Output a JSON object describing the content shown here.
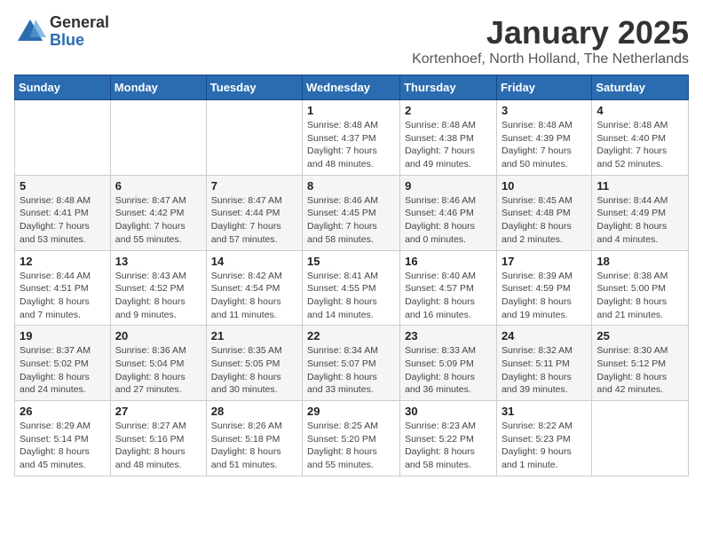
{
  "header": {
    "logo_general": "General",
    "logo_blue": "Blue",
    "title": "January 2025",
    "location": "Kortenhoef, North Holland, The Netherlands"
  },
  "days_of_week": [
    "Sunday",
    "Monday",
    "Tuesday",
    "Wednesday",
    "Thursday",
    "Friday",
    "Saturday"
  ],
  "weeks": [
    [
      {
        "day": "",
        "info": ""
      },
      {
        "day": "",
        "info": ""
      },
      {
        "day": "",
        "info": ""
      },
      {
        "day": "1",
        "info": "Sunrise: 8:48 AM\nSunset: 4:37 PM\nDaylight: 7 hours\nand 48 minutes."
      },
      {
        "day": "2",
        "info": "Sunrise: 8:48 AM\nSunset: 4:38 PM\nDaylight: 7 hours\nand 49 minutes."
      },
      {
        "day": "3",
        "info": "Sunrise: 8:48 AM\nSunset: 4:39 PM\nDaylight: 7 hours\nand 50 minutes."
      },
      {
        "day": "4",
        "info": "Sunrise: 8:48 AM\nSunset: 4:40 PM\nDaylight: 7 hours\nand 52 minutes."
      }
    ],
    [
      {
        "day": "5",
        "info": "Sunrise: 8:48 AM\nSunset: 4:41 PM\nDaylight: 7 hours\nand 53 minutes."
      },
      {
        "day": "6",
        "info": "Sunrise: 8:47 AM\nSunset: 4:42 PM\nDaylight: 7 hours\nand 55 minutes."
      },
      {
        "day": "7",
        "info": "Sunrise: 8:47 AM\nSunset: 4:44 PM\nDaylight: 7 hours\nand 57 minutes."
      },
      {
        "day": "8",
        "info": "Sunrise: 8:46 AM\nSunset: 4:45 PM\nDaylight: 7 hours\nand 58 minutes."
      },
      {
        "day": "9",
        "info": "Sunrise: 8:46 AM\nSunset: 4:46 PM\nDaylight: 8 hours\nand 0 minutes."
      },
      {
        "day": "10",
        "info": "Sunrise: 8:45 AM\nSunset: 4:48 PM\nDaylight: 8 hours\nand 2 minutes."
      },
      {
        "day": "11",
        "info": "Sunrise: 8:44 AM\nSunset: 4:49 PM\nDaylight: 8 hours\nand 4 minutes."
      }
    ],
    [
      {
        "day": "12",
        "info": "Sunrise: 8:44 AM\nSunset: 4:51 PM\nDaylight: 8 hours\nand 7 minutes."
      },
      {
        "day": "13",
        "info": "Sunrise: 8:43 AM\nSunset: 4:52 PM\nDaylight: 8 hours\nand 9 minutes."
      },
      {
        "day": "14",
        "info": "Sunrise: 8:42 AM\nSunset: 4:54 PM\nDaylight: 8 hours\nand 11 minutes."
      },
      {
        "day": "15",
        "info": "Sunrise: 8:41 AM\nSunset: 4:55 PM\nDaylight: 8 hours\nand 14 minutes."
      },
      {
        "day": "16",
        "info": "Sunrise: 8:40 AM\nSunset: 4:57 PM\nDaylight: 8 hours\nand 16 minutes."
      },
      {
        "day": "17",
        "info": "Sunrise: 8:39 AM\nSunset: 4:59 PM\nDaylight: 8 hours\nand 19 minutes."
      },
      {
        "day": "18",
        "info": "Sunrise: 8:38 AM\nSunset: 5:00 PM\nDaylight: 8 hours\nand 21 minutes."
      }
    ],
    [
      {
        "day": "19",
        "info": "Sunrise: 8:37 AM\nSunset: 5:02 PM\nDaylight: 8 hours\nand 24 minutes."
      },
      {
        "day": "20",
        "info": "Sunrise: 8:36 AM\nSunset: 5:04 PM\nDaylight: 8 hours\nand 27 minutes."
      },
      {
        "day": "21",
        "info": "Sunrise: 8:35 AM\nSunset: 5:05 PM\nDaylight: 8 hours\nand 30 minutes."
      },
      {
        "day": "22",
        "info": "Sunrise: 8:34 AM\nSunset: 5:07 PM\nDaylight: 8 hours\nand 33 minutes."
      },
      {
        "day": "23",
        "info": "Sunrise: 8:33 AM\nSunset: 5:09 PM\nDaylight: 8 hours\nand 36 minutes."
      },
      {
        "day": "24",
        "info": "Sunrise: 8:32 AM\nSunset: 5:11 PM\nDaylight: 8 hours\nand 39 minutes."
      },
      {
        "day": "25",
        "info": "Sunrise: 8:30 AM\nSunset: 5:12 PM\nDaylight: 8 hours\nand 42 minutes."
      }
    ],
    [
      {
        "day": "26",
        "info": "Sunrise: 8:29 AM\nSunset: 5:14 PM\nDaylight: 8 hours\nand 45 minutes."
      },
      {
        "day": "27",
        "info": "Sunrise: 8:27 AM\nSunset: 5:16 PM\nDaylight: 8 hours\nand 48 minutes."
      },
      {
        "day": "28",
        "info": "Sunrise: 8:26 AM\nSunset: 5:18 PM\nDaylight: 8 hours\nand 51 minutes."
      },
      {
        "day": "29",
        "info": "Sunrise: 8:25 AM\nSunset: 5:20 PM\nDaylight: 8 hours\nand 55 minutes."
      },
      {
        "day": "30",
        "info": "Sunrise: 8:23 AM\nSunset: 5:22 PM\nDaylight: 8 hours\nand 58 minutes."
      },
      {
        "day": "31",
        "info": "Sunrise: 8:22 AM\nSunset: 5:23 PM\nDaylight: 9 hours\nand 1 minute."
      },
      {
        "day": "",
        "info": ""
      }
    ]
  ]
}
